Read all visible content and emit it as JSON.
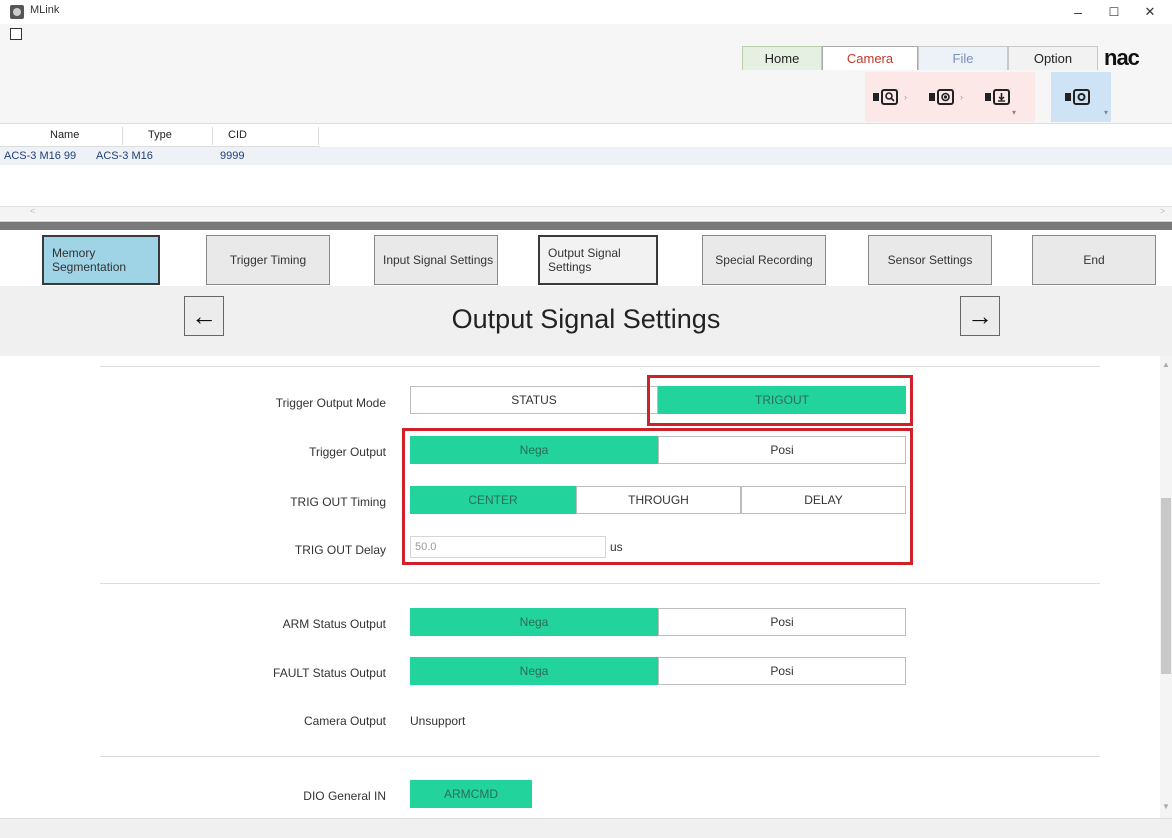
{
  "window": {
    "title": "MLink",
    "minimize": "–",
    "maximize": "☐",
    "close": "✕"
  },
  "ribbon": {
    "tabs": [
      {
        "label": "Home"
      },
      {
        "label": "Camera"
      },
      {
        "label": "File"
      },
      {
        "label": "Option"
      }
    ],
    "brand": "nac",
    "tools": [
      "camera-search-icon",
      "camera-record-icon",
      "camera-save-icon",
      "camera-settings-icon"
    ]
  },
  "device_list": {
    "columns": [
      "Name",
      "Type",
      "CID"
    ],
    "rows": [
      {
        "name": "ACS-3 M16 99",
        "type": "ACS-3 M16",
        "cid": "9999"
      }
    ]
  },
  "steps": [
    {
      "label": "Memory Segmentation",
      "state": "active"
    },
    {
      "label": "Trigger Timing",
      "state": "normal"
    },
    {
      "label": "Input Signal Settings",
      "state": "normal"
    },
    {
      "label": "Output Signal Settings",
      "state": "current"
    },
    {
      "label": "Special Recording",
      "state": "normal"
    },
    {
      "label": "Sensor Settings",
      "state": "normal"
    },
    {
      "label": "End",
      "state": "normal"
    }
  ],
  "page": {
    "title": "Output Signal Settings",
    "prev_arrow": "←",
    "next_arrow": "→"
  },
  "settings": {
    "trigger_output_mode": {
      "label": "Trigger Output Mode",
      "options": [
        "STATUS",
        "TRIGOUT"
      ],
      "selected": "TRIGOUT"
    },
    "trigger_output": {
      "label": "Trigger Output",
      "options": [
        "Nega",
        "Posi"
      ],
      "selected": "Nega"
    },
    "trig_out_timing": {
      "label": "TRIG OUT Timing",
      "options": [
        "CENTER",
        "THROUGH",
        "DELAY"
      ],
      "selected": "CENTER"
    },
    "trig_out_delay": {
      "label": "TRIG OUT Delay",
      "value": "50.0",
      "unit": "us"
    },
    "arm_status_output": {
      "label": "ARM Status Output",
      "options": [
        "Nega",
        "Posi"
      ],
      "selected": "Nega"
    },
    "fault_status_output": {
      "label": "FAULT Status Output",
      "options": [
        "Nega",
        "Posi"
      ],
      "selected": "Nega"
    },
    "camera_output": {
      "label": "Camera Output",
      "value": "Unsupport"
    },
    "dio_general_in": {
      "label": "DIO General IN",
      "value": "ARMCMD"
    }
  },
  "colors": {
    "selected_green": "#22d39b",
    "highlight_red": "#d0202a",
    "active_step_blue": "#9fd4e6"
  }
}
